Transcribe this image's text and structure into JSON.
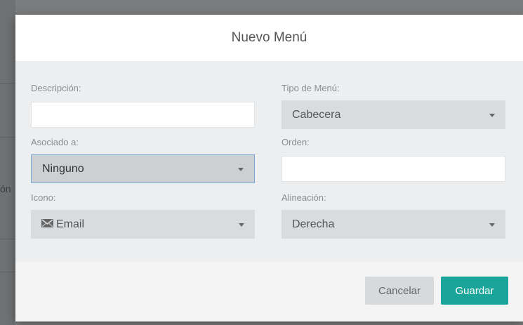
{
  "backdrop": {
    "peek_text": "ón"
  },
  "modal": {
    "title": "Nuevo Menú",
    "fields": {
      "descripcion": {
        "label": "Descripción:",
        "value": ""
      },
      "tipo_menu": {
        "label": "Tipo de Menú:",
        "value": "Cabecera"
      },
      "asociado": {
        "label": "Asociado a:",
        "value": "Ninguno"
      },
      "orden": {
        "label": "Orden:",
        "value": ""
      },
      "icono": {
        "label": "Icono:",
        "value": "Email",
        "icon": "envelope-icon"
      },
      "alineacion": {
        "label": "Alineación:",
        "value": "Derecha"
      }
    },
    "buttons": {
      "cancel": "Cancelar",
      "save": "Guardar"
    }
  },
  "colors": {
    "primary": "#1aa59a",
    "focus_border": "#7aa7d8"
  }
}
